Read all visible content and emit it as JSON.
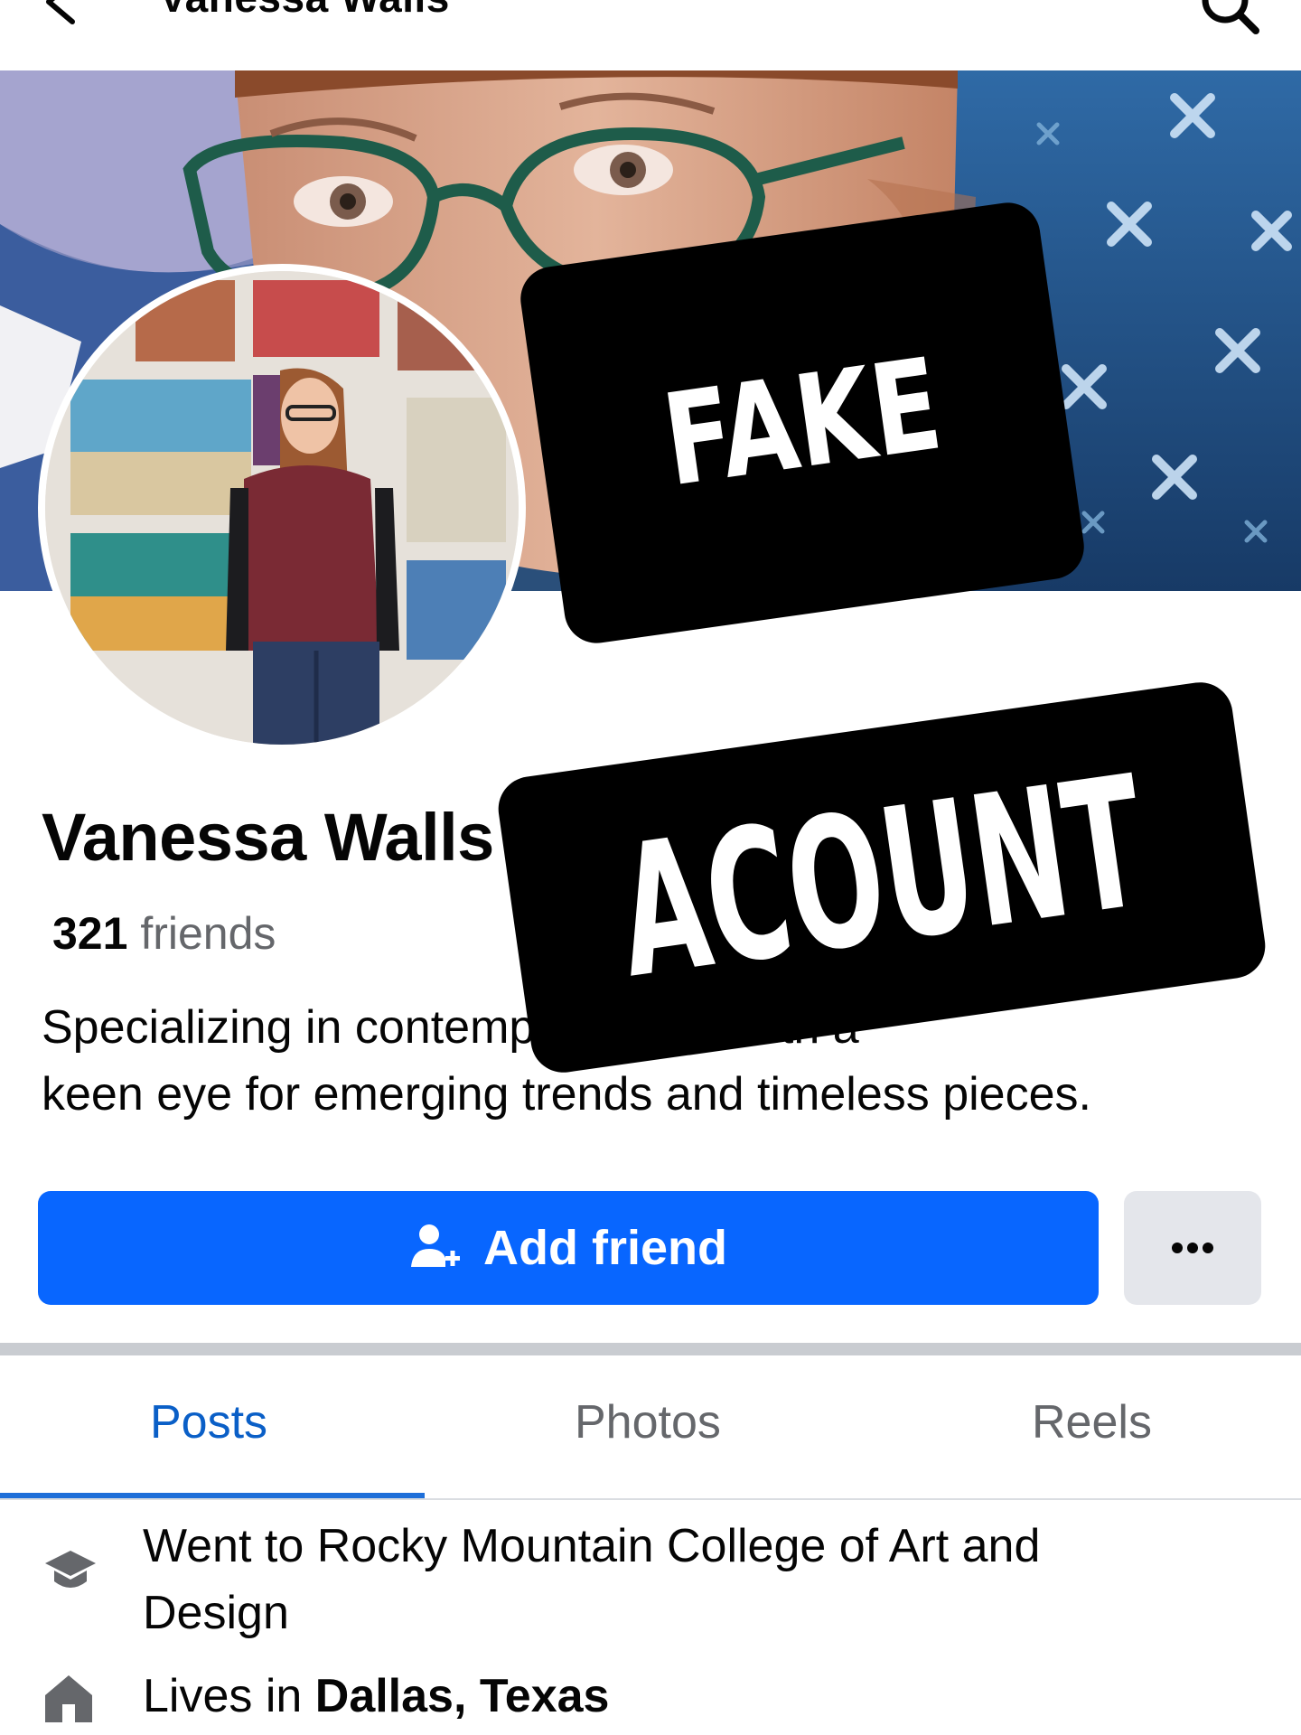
{
  "header": {
    "title": "Vanessa Walls"
  },
  "profile": {
    "name": "Vanessa Walls",
    "friends_count": "321",
    "friends_label": "friends",
    "bio_line1": "Specializing in contemporary art, with a",
    "bio_line2": "keen eye for emerging trends and timeless pieces."
  },
  "actions": {
    "add_friend_label": "Add friend",
    "more_label": "•••"
  },
  "tabs": [
    {
      "label": "Posts",
      "active": true
    },
    {
      "label": "Photos",
      "active": false
    },
    {
      "label": "Reels",
      "active": false
    }
  ],
  "intro": {
    "education_line1": "Went to Rocky Mountain College of Art and",
    "education_line2": "Design",
    "lives_prefix": "Lives in",
    "lives_place": "Dallas, Texas"
  },
  "stickers": {
    "top": "FAKE",
    "bottom": "ACOUNT"
  },
  "icons": {
    "back": "back-arrow-icon",
    "search": "search-icon",
    "add_friend": "add-person-icon",
    "more": "more-dots-icon",
    "education": "graduation-cap-icon",
    "home": "home-icon"
  },
  "colors": {
    "primary_button": "#0866ff",
    "secondary_button": "#e4e6eb",
    "active_tab": "#0a5fc7",
    "muted_text": "#65676b",
    "sticker": "#000000"
  }
}
